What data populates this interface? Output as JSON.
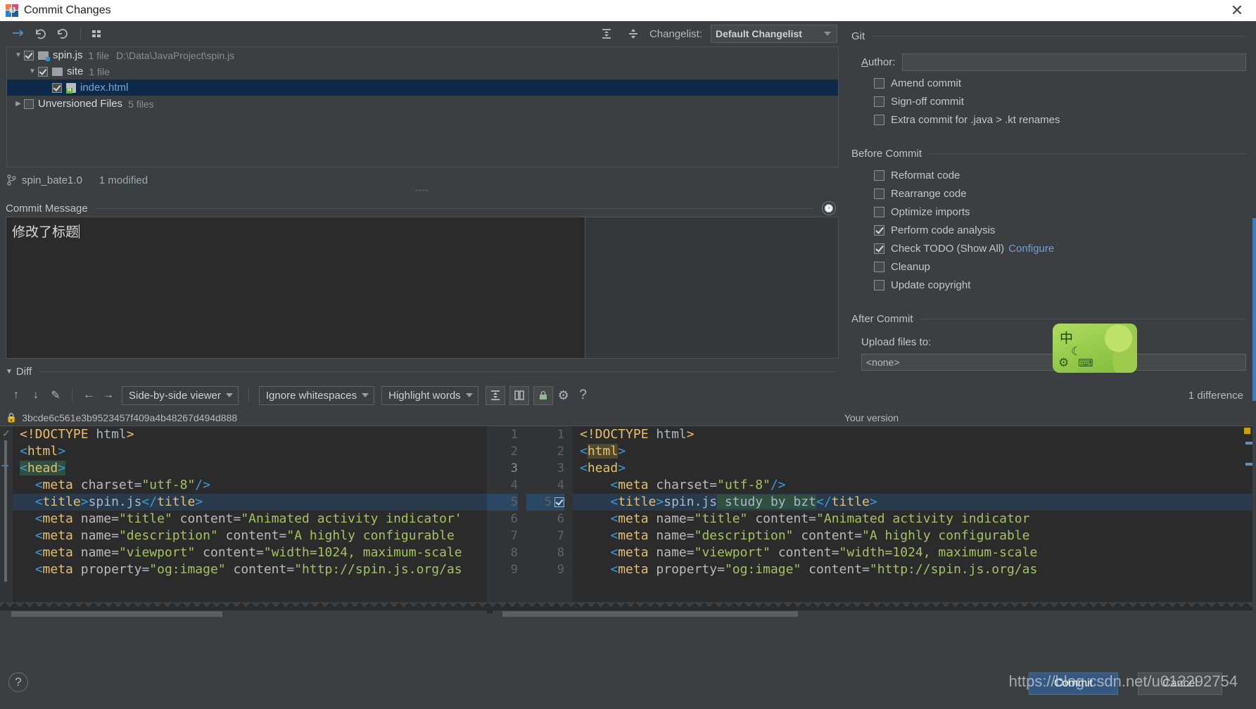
{
  "window": {
    "title": "Commit Changes",
    "close_label": "✕",
    "app_icon": "intellij-idea-icon"
  },
  "changes_toolbar": {
    "icons": [
      {
        "name": "show-diff-icon",
        "glyph": "↴"
      },
      {
        "name": "revert-icon",
        "glyph": "↶"
      },
      {
        "name": "refresh-icon",
        "glyph": "⟳"
      },
      {
        "name": "group-by-icon",
        "glyph": "▦"
      }
    ],
    "expand_all_glyph": "⩝",
    "collapse_all_glyph": "⩞",
    "changelist_label": "Changelist:",
    "changelist_value": "Default Changelist"
  },
  "tree": {
    "rows": [
      {
        "name": "spin.js",
        "meta": "1 file",
        "path": "D:\\Data\\JavaProject\\spin.js",
        "twisty": "▼",
        "checked": true,
        "indent": 0,
        "icon": "folder-modified-icon",
        "selected": false
      },
      {
        "name": "site",
        "meta": "1 file",
        "path": "",
        "twisty": "▼",
        "checked": true,
        "indent": 1,
        "icon": "folder-icon",
        "selected": false
      },
      {
        "name": "index.html",
        "meta": "",
        "path": "",
        "twisty": "",
        "checked": true,
        "indent": 2,
        "icon": "html-file-icon",
        "selected": true
      },
      {
        "name": "Unversioned Files",
        "meta": "5 files",
        "path": "",
        "twisty": "▶",
        "checked": false,
        "indent": 0,
        "icon": "none",
        "selected": false
      }
    ]
  },
  "branch_row": {
    "icon": "branch-icon",
    "branch": "spin_bate1.0",
    "modified": "1 modified"
  },
  "commit_message": {
    "label": "Commit Message",
    "value": "修改了标题",
    "history_icon": "clock-icon"
  },
  "diff_section": {
    "caret": "▼",
    "title": "Diff",
    "toolbar": {
      "prev_diff_glyph": "↑",
      "next_diff_glyph": "↓",
      "edit_glyph": "✎",
      "apply_left_glyph": "←",
      "apply_right_glyph": "→",
      "viewer_mode": "Side-by-side viewer",
      "whitespace_mode": "Ignore whitespaces",
      "highlight_mode": "Highlight words",
      "collapse_unchanged_glyph": "⩟",
      "synchronize_glyph": "◫",
      "readonly_glyph": "ὑ2",
      "settings_glyph": "⚙",
      "help_glyph": "?"
    },
    "difference_count": "1 difference",
    "left_header": "3bcde6c561e3b9523457f409a4b48267d494d888",
    "right_header": "Your version",
    "left_lines": [
      "<!DOCTYPE html>",
      "<html>",
      "<head>",
      "  <meta charset=\"utf-8\"/>",
      "  <title>spin.js</title>",
      "  <meta name=\"title\" content=\"Animated activity indicator'",
      "  <meta name=\"description\" content=\"A highly configurable",
      "  <meta name=\"viewport\" content=\"width=1024, maximum-scale",
      "  <meta property=\"og:image\" content=\"http://spin.js.org/as"
    ],
    "right_lines": [
      "<!DOCTYPE html>",
      "<html>",
      "<head>",
      "    <meta charset=\"utf-8\"/>",
      "    <title>spin.js study by bzt</title>",
      "    <meta name=\"title\" content=\"Animated activity indicator",
      "    <meta name=\"description\" content=\"A highly configurable",
      "    <meta name=\"viewport\" content=\"width=1024, maximum-scale",
      "    <meta property=\"og:image\" content=\"http://spin.js.org/as"
    ],
    "line_numbers_left": [
      "1",
      "2",
      "3",
      "4",
      "5",
      "6",
      "7",
      "8",
      "9"
    ],
    "line_numbers_right": [
      "1",
      "2",
      "3",
      "4",
      "5",
      "6",
      "7",
      "8",
      "9"
    ],
    "changed_line_index": 4,
    "changed_line_accept_icon": "accept-change-checkbox"
  },
  "git_panel": {
    "section_title": "Git",
    "author_label": "Author:",
    "author_value": "",
    "options": [
      {
        "label": "Amend commit",
        "checked": false
      },
      {
        "label": "Sign-off commit",
        "checked": false
      },
      {
        "label": "Extra commit for .java > .kt renames",
        "checked": false
      }
    ]
  },
  "before_commit": {
    "section_title": "Before Commit",
    "options": [
      {
        "label": "Reformat code",
        "checked": false,
        "link": ""
      },
      {
        "label": "Rearrange code",
        "checked": false,
        "link": ""
      },
      {
        "label": "Optimize imports",
        "checked": false,
        "link": ""
      },
      {
        "label": "Perform code analysis",
        "checked": true,
        "link": ""
      },
      {
        "label": "Check TODO (Show All)",
        "checked": true,
        "link": "Configure"
      },
      {
        "label": "Cleanup",
        "checked": false,
        "link": ""
      },
      {
        "label": "Update copyright",
        "checked": false,
        "link": ""
      }
    ]
  },
  "after_commit": {
    "section_title": "After Commit",
    "upload_label": "Upload files to:",
    "upload_value": "<none>"
  },
  "ime_widget": {
    "mode": "中",
    "moon_icon": "moon-icon",
    "gear_icon": "gear-icon",
    "keyboard_icon": "keyboard-icon"
  },
  "bottom_bar": {
    "help_glyph": "?",
    "commit_label": "Commit",
    "cancel_label": "Cancel",
    "watermark": "https://blog.csdn.net/u012292754"
  },
  "colors": {
    "accent_blue": "#365880",
    "selection_blue": "#0d2a4a",
    "panel_bg": "#3c3f41",
    "editor_bg": "#2b2b2b",
    "link": "#6f9fd0",
    "inserted_green": "#2f4f3f"
  }
}
